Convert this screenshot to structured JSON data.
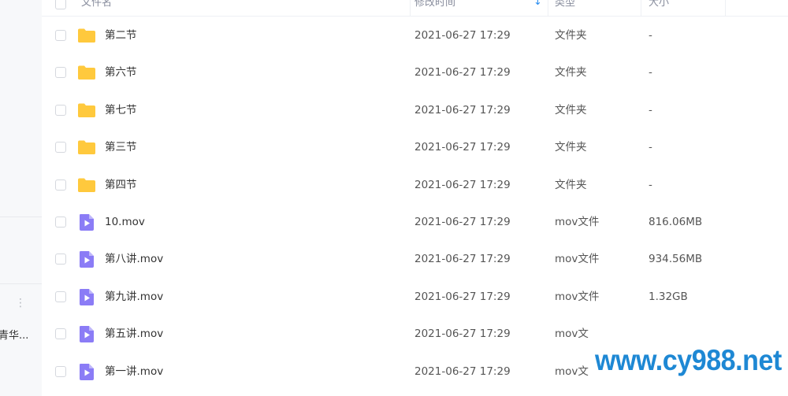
{
  "sidebar": {
    "more_glyph": "⋮",
    "truncated_item": "青华..."
  },
  "header": {
    "name": "文件名",
    "modified": "修改时间",
    "sort_arrow": "↓",
    "type": "类型",
    "size": "大小"
  },
  "files": [
    {
      "name": "第二节",
      "time": "2021-06-27 17:29",
      "type": "文件夹",
      "size": "-",
      "icon": "folder-icon"
    },
    {
      "name": "第六节",
      "time": "2021-06-27 17:29",
      "type": "文件夹",
      "size": "-",
      "icon": "folder-icon"
    },
    {
      "name": "第七节",
      "time": "2021-06-27 17:29",
      "type": "文件夹",
      "size": "-",
      "icon": "folder-icon"
    },
    {
      "name": "第三节",
      "time": "2021-06-27 17:29",
      "type": "文件夹",
      "size": "-",
      "icon": "folder-icon"
    },
    {
      "name": "第四节",
      "time": "2021-06-27 17:29",
      "type": "文件夹",
      "size": "-",
      "icon": "folder-icon"
    },
    {
      "name": "10.mov",
      "time": "2021-06-27 17:29",
      "type": "mov文件",
      "size": "816.06MB",
      "icon": "video-file-icon"
    },
    {
      "name": "第八讲.mov",
      "time": "2021-06-27 17:29",
      "type": "mov文件",
      "size": "934.56MB",
      "icon": "video-file-icon"
    },
    {
      "name": "第九讲.mov",
      "time": "2021-06-27 17:29",
      "type": "mov文件",
      "size": "1.32GB",
      "icon": "video-file-icon"
    },
    {
      "name": "第五讲.mov",
      "time": "2021-06-27 17:29",
      "type": "mov文",
      "size": "",
      "icon": "video-file-icon"
    },
    {
      "name": "第一讲.mov",
      "time": "2021-06-27 17:29",
      "type": "mov文",
      "size": "",
      "icon": "video-file-icon"
    }
  ],
  "watermark": "www.cy988.net",
  "colors": {
    "folder": "#FFC93D",
    "video_file": "#8B7CF6",
    "accent": "#2B8EF0",
    "watermark": "#1E88D4"
  }
}
